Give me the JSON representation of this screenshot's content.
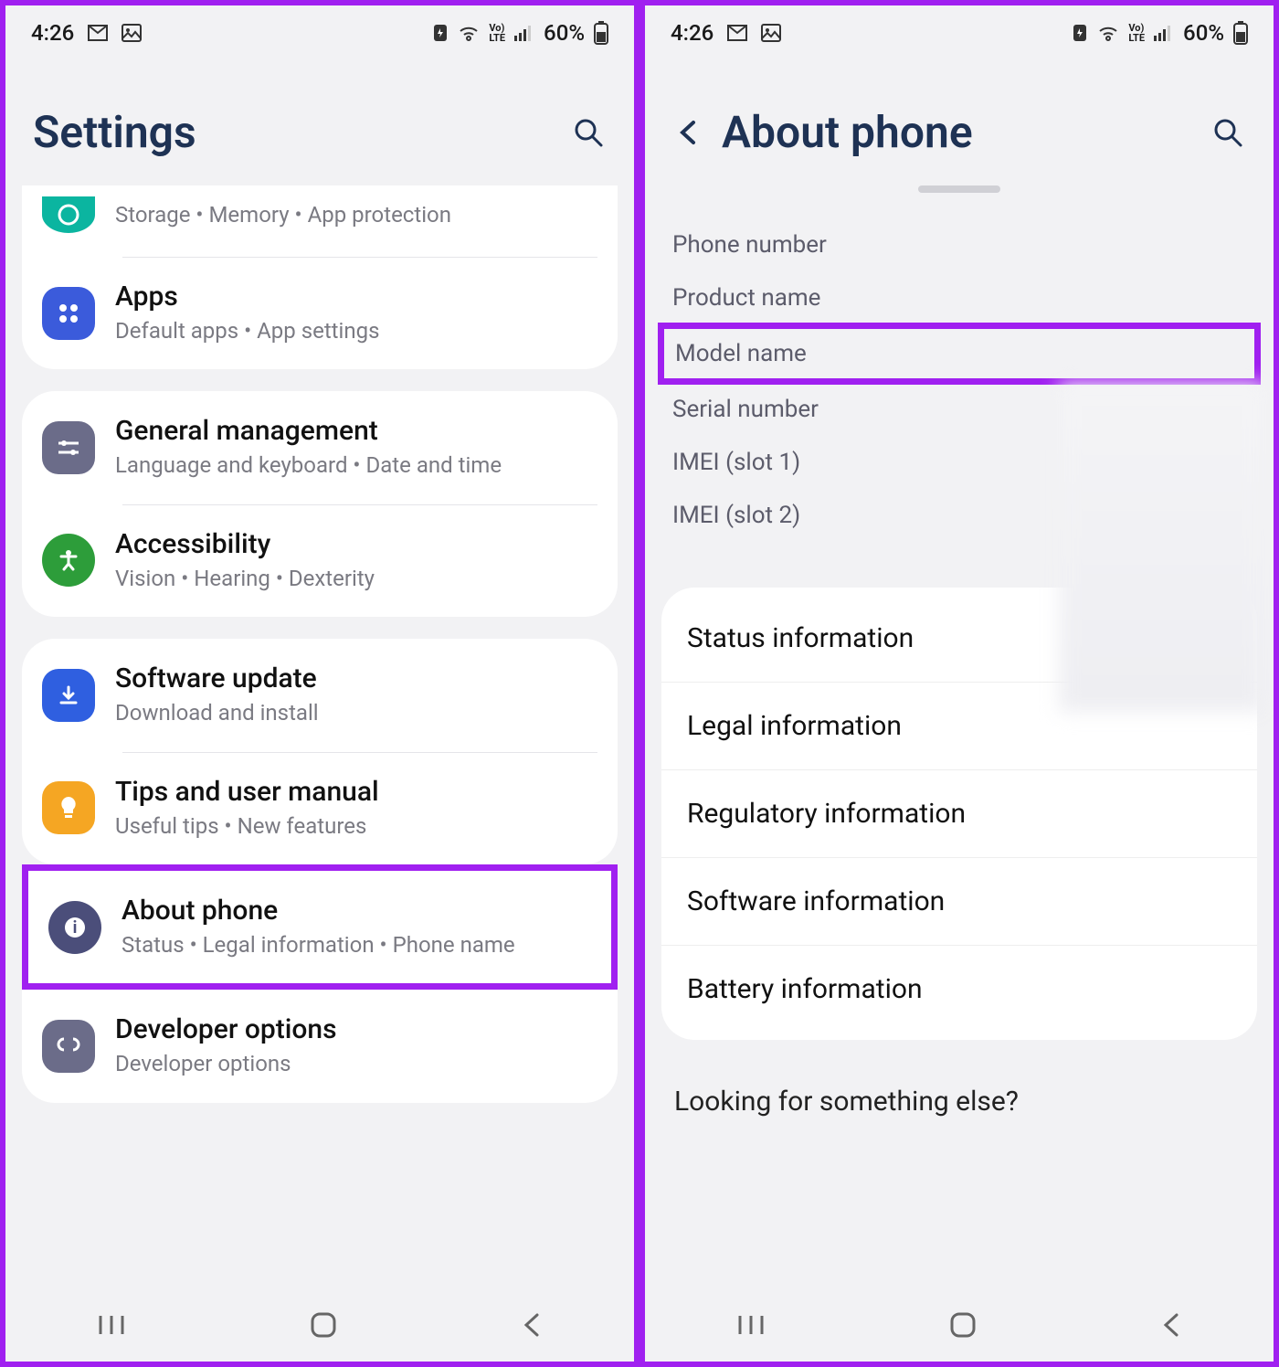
{
  "status": {
    "time": "4:26",
    "battery_pct": "60%"
  },
  "left": {
    "header_title": "Settings",
    "groups": [
      {
        "rows": [
          {
            "id": "device-care-partial",
            "title": "",
            "subtitle": "Storage  •  Memory  •  App protection",
            "color": "#0bb5a0"
          },
          {
            "id": "apps",
            "title": "Apps",
            "subtitle": "Default apps  •  App settings",
            "color": "#3b5bdb"
          }
        ]
      },
      {
        "rows": [
          {
            "id": "general-management",
            "title": "General management",
            "subtitle": "Language and keyboard  •  Date and time",
            "color": "#6b6c89"
          },
          {
            "id": "accessibility",
            "title": "Accessibility",
            "subtitle": "Vision  •  Hearing  •  Dexterity",
            "color": "#2d9d3a"
          }
        ]
      },
      {
        "rows": [
          {
            "id": "software-update",
            "title": "Software update",
            "subtitle": "Download and install",
            "color": "#2f5fe0"
          },
          {
            "id": "tips",
            "title": "Tips and user manual",
            "subtitle": "Useful tips  •  New features",
            "color": "#f5a623"
          },
          {
            "id": "about-phone",
            "title": "About phone",
            "subtitle": "Status  •  Legal information  •  Phone name",
            "color": "#4b4e7a",
            "highlighted": true
          },
          {
            "id": "developer-options",
            "title": "Developer options",
            "subtitle": "Developer options",
            "color": "#6b6c89"
          }
        ]
      }
    ]
  },
  "right": {
    "header_title": "About phone",
    "info_rows": [
      {
        "label": "Phone number"
      },
      {
        "label": "Product name"
      },
      {
        "label": "Model name",
        "highlighted": true
      },
      {
        "label": "Serial number"
      },
      {
        "label": "IMEI (slot 1)"
      },
      {
        "label": "IMEI (slot 2)"
      }
    ],
    "list_items": [
      "Status information",
      "Legal information",
      "Regulatory information",
      "Software information",
      "Battery information"
    ],
    "footer_question": "Looking for something else?"
  }
}
